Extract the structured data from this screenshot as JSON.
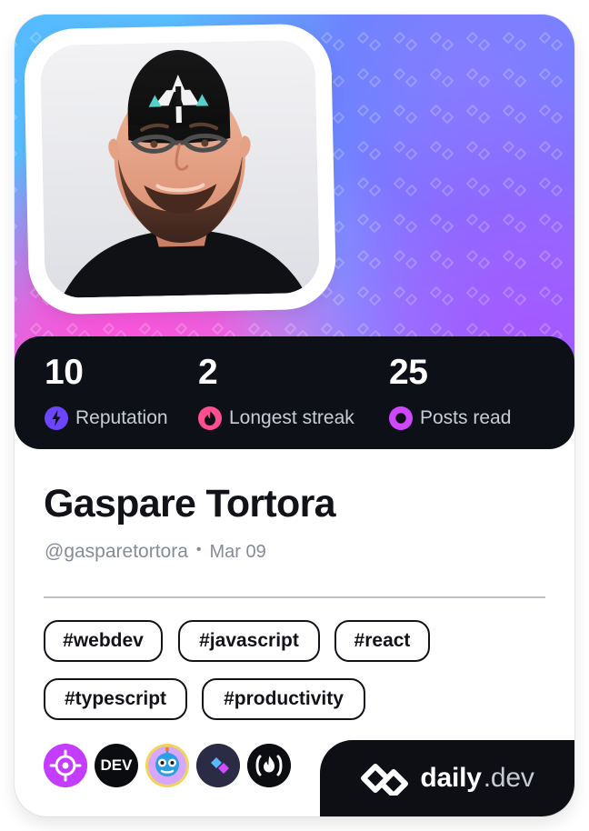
{
  "profile": {
    "name": "Gaspare Tortora",
    "handle": "@gasparetortora",
    "separator": "•",
    "date": "Mar 09"
  },
  "stats": {
    "reputation": {
      "value": "10",
      "label": "Reputation",
      "icon": "lightning-icon",
      "color": "#6b45ff"
    },
    "longest_streak": {
      "value": "2",
      "label": "Longest streak",
      "icon": "flame-icon",
      "color": "#ff4f8f"
    },
    "posts_read": {
      "value": "25",
      "label": "Posts read",
      "icon": "ring-icon",
      "color": "#cf47ff"
    }
  },
  "tags": [
    "#webdev",
    "#javascript",
    "#react",
    "#typescript",
    "#productivity"
  ],
  "sources": [
    {
      "icon": "target-icon",
      "color": "#c33cff"
    },
    {
      "icon": "dev-logo",
      "label": "DEV",
      "color": "#0b0c10"
    },
    {
      "icon": "robot-icon",
      "color": "#f1d55a"
    },
    {
      "icon": "daily-dev-source-icon",
      "color": "#2b2b46"
    },
    {
      "icon": "freecodecamp-icon",
      "color": "#0c0d10"
    }
  ],
  "brand": {
    "logo_icon": "daily-dev-logo-icon",
    "name": "daily",
    "suffix": ".dev"
  },
  "theme": {
    "dark": "#0e1017",
    "text": "#111318",
    "muted": "#878b96",
    "border": "#111318",
    "hero_gradient": [
      "#3fa4ff",
      "#65c8f1",
      "#9fb5ff",
      "#8b6dff",
      "#ff4fd8"
    ]
  }
}
